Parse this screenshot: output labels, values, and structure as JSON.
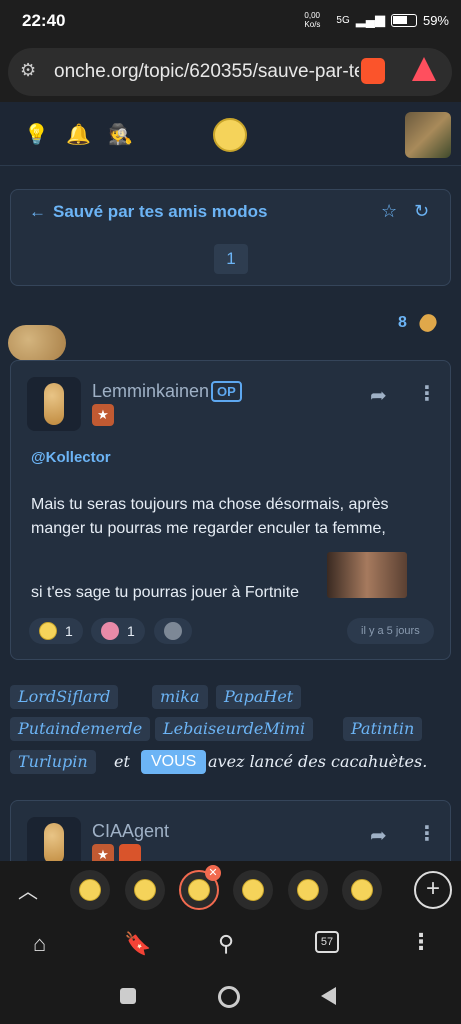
{
  "status_bar": {
    "time": "22:40",
    "network_speed": "0,00 Ko/s",
    "network": "5G",
    "battery": "59%"
  },
  "browser": {
    "url": "onche.org/topic/620355/sauve-par-te",
    "tab_count": "57"
  },
  "topic": {
    "title": "Sauvé par tes amis modos",
    "page": "1"
  },
  "peanut_count": "8",
  "post": {
    "author": "Lemminkainen",
    "op_label": "OP",
    "mention": "@Kollector",
    "paragraph1": "Mais tu seras toujours ma chose désormais, après manger tu pourras me regarder enculer ta femme,",
    "paragraph2": "si t'es sage tu pourras jouer à Fortnite",
    "reactions": [
      {
        "count": "1"
      },
      {
        "count": "1"
      }
    ],
    "time": "il y a 5 jours"
  },
  "throwers": {
    "names": [
      "LordSiflard",
      "mika",
      "PapaHet",
      "Putaindemerde",
      "LebaiseurdeMimi",
      "Patintin",
      "Turlupin"
    ],
    "connector": "et",
    "you": "VOUS",
    "suffix": "avez lancé des cacahuètes."
  },
  "post2": {
    "author": "CIAAgent"
  },
  "colors": {
    "accent": "#6cb4f5",
    "card": "#232f3f",
    "background": "#1e2836"
  }
}
